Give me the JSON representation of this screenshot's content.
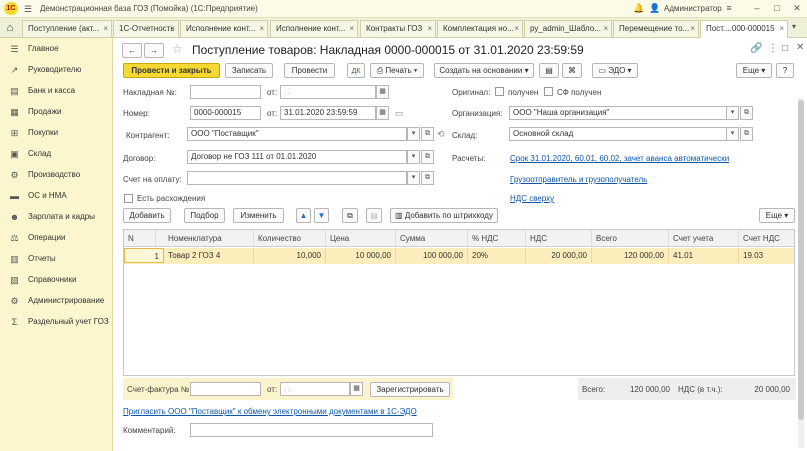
{
  "window": {
    "title": "Демонстрационная база ГОЗ (Помойка)  (1С:Предприятие)",
    "user": "Администратор",
    "logo": "1С"
  },
  "tabs": [
    {
      "label": "Поступление (акт..."
    },
    {
      "label": "1С-Отчетность"
    },
    {
      "label": "Исполнение конт..."
    },
    {
      "label": "Исполнение конт..."
    },
    {
      "label": "Контракты ГОЗ"
    },
    {
      "label": "Комплектация но..."
    },
    {
      "label": "ру_admin_Шабло..."
    },
    {
      "label": "Перемещение то..."
    },
    {
      "label": "Пост....000-000015"
    }
  ],
  "sidebar": {
    "items": [
      {
        "label": "Главное",
        "icon": "menu-icon"
      },
      {
        "label": "Руководителю",
        "icon": "chart-icon"
      },
      {
        "label": "Банк и касса",
        "icon": "bank-icon"
      },
      {
        "label": "Продажи",
        "icon": "sales-icon"
      },
      {
        "label": "Покупки",
        "icon": "cart-icon"
      },
      {
        "label": "Склад",
        "icon": "warehouse-icon"
      },
      {
        "label": "Производство",
        "icon": "factory-icon"
      },
      {
        "label": "ОС и НМА",
        "icon": "truck-icon"
      },
      {
        "label": "Зарплата и кадры",
        "icon": "people-icon"
      },
      {
        "label": "Операции",
        "icon": "operations-icon"
      },
      {
        "label": "Отчеты",
        "icon": "reports-icon"
      },
      {
        "label": "Справочники",
        "icon": "books-icon"
      },
      {
        "label": "Администрирование",
        "icon": "gear-icon"
      },
      {
        "label": "Раздельный учет ГОЗ",
        "icon": "separate-icon"
      }
    ]
  },
  "doc": {
    "title": "Поступление товаров: Накладная 0000-000015 от 31.01.2020 23:59:59",
    "toolbar": {
      "post_close": "Провести и закрыть",
      "save": "Записать",
      "post": "Провести",
      "print": "Печать",
      "create_based": "Создать на основании",
      "edo": "ЭДО",
      "more": "Еще"
    },
    "fields": {
      "nakl_label": "Накладная №:",
      "nakl_value": "",
      "from_label": "от:",
      "nakl_date": " .  .",
      "number_label": "Номер:",
      "number_value": "0000-000015",
      "date_value": "31.01.2020 23:59:59",
      "original_label": "Оригинал:",
      "received_label": "получен",
      "sf_received_label": "СФ получен",
      "org_label": "Организация:",
      "org_value": "ООО \"Наша организация\"",
      "contractor_label": "Контрагент:",
      "contractor_value": "ООО \"Поставщик\"",
      "warehouse_label": "Склад:",
      "warehouse_value": "Основной склад",
      "contract_label": "Договор:",
      "contract_value": "Договор не ГОЗ 111 от 01.01.2020",
      "settlements_label": "Расчеты:",
      "settlements_link": "Срок 31.01.2020, 60.01, 60.02, зачет аванса автоматически",
      "invoice_label": "Счет на оплату:",
      "invoice_value": "",
      "shipper_link": "Грузоотправитель и грузополучатель",
      "vat_link": "НДС сверху",
      "discrepancies_label": "Есть расхождения"
    },
    "table_toolbar": {
      "add": "Добавить",
      "select": "Подбор",
      "change": "Изменить",
      "barcode": "Добавить по штрихкоду",
      "more": "Еще"
    },
    "table": {
      "columns": [
        "N",
        "Номенклатура",
        "Количество",
        "Цена",
        "Сумма",
        "% НДС",
        "НДС",
        "Всего",
        "Счет учета",
        "Счет НДС"
      ],
      "rows": [
        [
          "1",
          "Товар 2 ГОЗ 4",
          "10,000",
          "10 000,00",
          "100 000,00",
          "20%",
          "20 000,00",
          "120 000,00",
          "41.01",
          "19.03"
        ]
      ]
    },
    "footer": {
      "sf_label": "Счет-фактура №:",
      "sf_value": "",
      "from_label": "от:",
      "sf_date": " .  .",
      "register": "Зарегистрировать",
      "total_label": "Всего:",
      "total_value": "120 000,00",
      "vat_label": "НДС (в т.ч.):",
      "vat_value": "20 000,00",
      "invite_link": "Пригласить ООО \"Поставщик\" к обмену электронными документами в 1С-ЭДО",
      "comment_label": "Комментарий:",
      "comment_value": ""
    }
  }
}
